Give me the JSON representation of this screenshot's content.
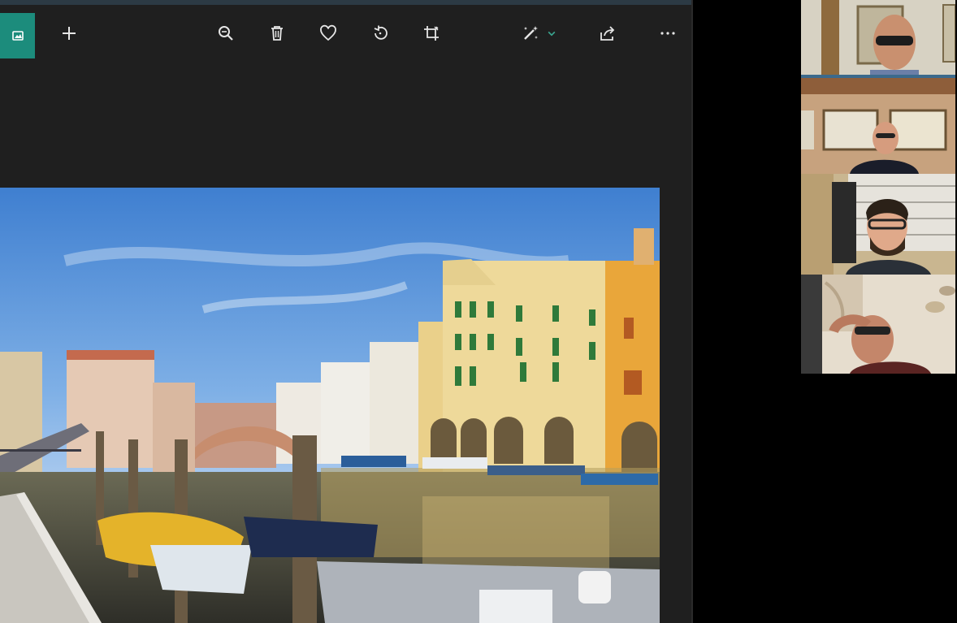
{
  "toolbar": {
    "buttons": [
      {
        "name": "edit-photo-button",
        "icon": "photo-edit-icon"
      },
      {
        "name": "add-button",
        "icon": "plus-icon"
      },
      {
        "name": "zoom-button",
        "icon": "zoom-icon"
      },
      {
        "name": "delete-button",
        "icon": "trash-icon"
      },
      {
        "name": "favorite-button",
        "icon": "heart-icon"
      },
      {
        "name": "rotate-button",
        "icon": "rotate-icon"
      },
      {
        "name": "crop-button",
        "icon": "crop-icon"
      },
      {
        "name": "enhance-button",
        "icon": "magic-wand-icon"
      },
      {
        "name": "enhance-dropdown",
        "icon": "chevron-down-icon"
      },
      {
        "name": "share-button",
        "icon": "share-icon"
      },
      {
        "name": "more-button",
        "icon": "more-icon"
      }
    ]
  },
  "photo": {
    "subject": "canal-town-photo"
  },
  "participants": [
    {
      "id": "participant-1"
    },
    {
      "id": "participant-2"
    },
    {
      "id": "participant-3"
    },
    {
      "id": "participant-4"
    }
  ],
  "colors": {
    "accent": "#1c8c7c",
    "toolbar_bg": "#1f1f1f",
    "icon": "#e6e6e6",
    "enhance_chevron": "#3aa58f"
  }
}
